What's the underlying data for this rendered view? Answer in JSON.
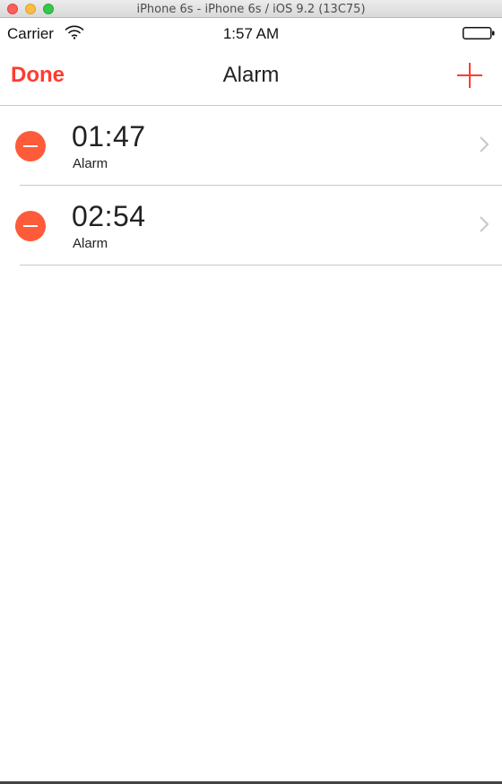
{
  "window": {
    "title": "iPhone 6s - iPhone 6s / iOS 9.2 (13C75)"
  },
  "status_bar": {
    "carrier": "Carrier",
    "time": "1:57 AM",
    "wifi_icon": "wifi-icon",
    "battery_icon": "battery-icon"
  },
  "nav": {
    "done_label": "Done",
    "title": "Alarm",
    "add_icon": "plus-icon"
  },
  "colors": {
    "accent": "#ff3b30",
    "delete": "#fe5b3a",
    "separator": "#c8c7cc"
  },
  "alarms": [
    {
      "time": "01:47",
      "label": "Alarm"
    },
    {
      "time": "02:54",
      "label": "Alarm"
    }
  ]
}
